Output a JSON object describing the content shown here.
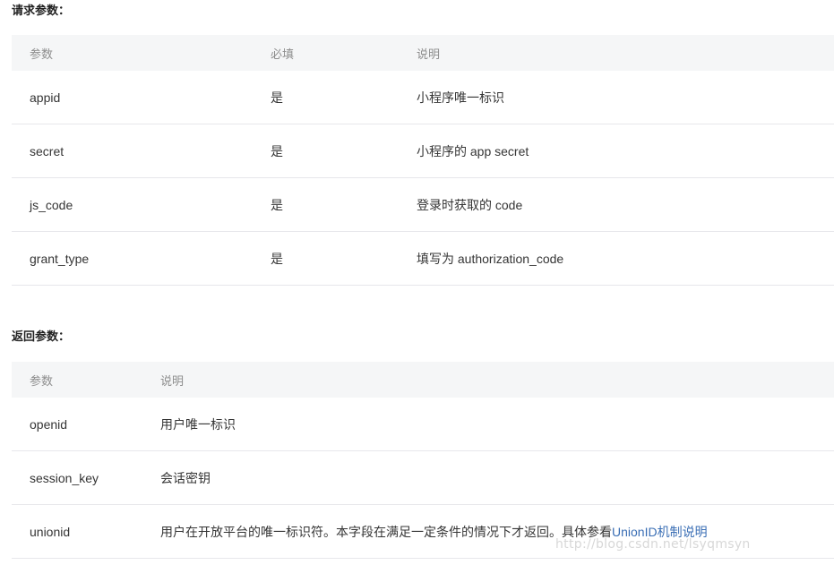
{
  "request_section": {
    "title": "请求参数：",
    "headers": {
      "name": "参数",
      "required": "必填",
      "desc": "说明"
    },
    "rows": [
      {
        "name": "appid",
        "required": "是",
        "desc": "小程序唯一标识"
      },
      {
        "name": "secret",
        "required": "是",
        "desc": "小程序的 app secret"
      },
      {
        "name": "js_code",
        "required": "是",
        "desc": "登录时获取的 code"
      },
      {
        "name": "grant_type",
        "required": "是",
        "desc": "填写为 authorization_code"
      }
    ]
  },
  "response_section": {
    "title": "返回参数：",
    "headers": {
      "name": "参数",
      "desc": "说明"
    },
    "rows": [
      {
        "name": "openid",
        "desc": "用户唯一标识"
      },
      {
        "name": "session_key",
        "desc": "会话密钥"
      },
      {
        "name": "unionid",
        "desc": "用户在开放平台的唯一标识符。本字段在满足一定条件的情况下才返回。具体参看",
        "link": "UnionID机制说明"
      }
    ]
  },
  "watermark": "http://blog.csdn.net/lsyqmsyn"
}
